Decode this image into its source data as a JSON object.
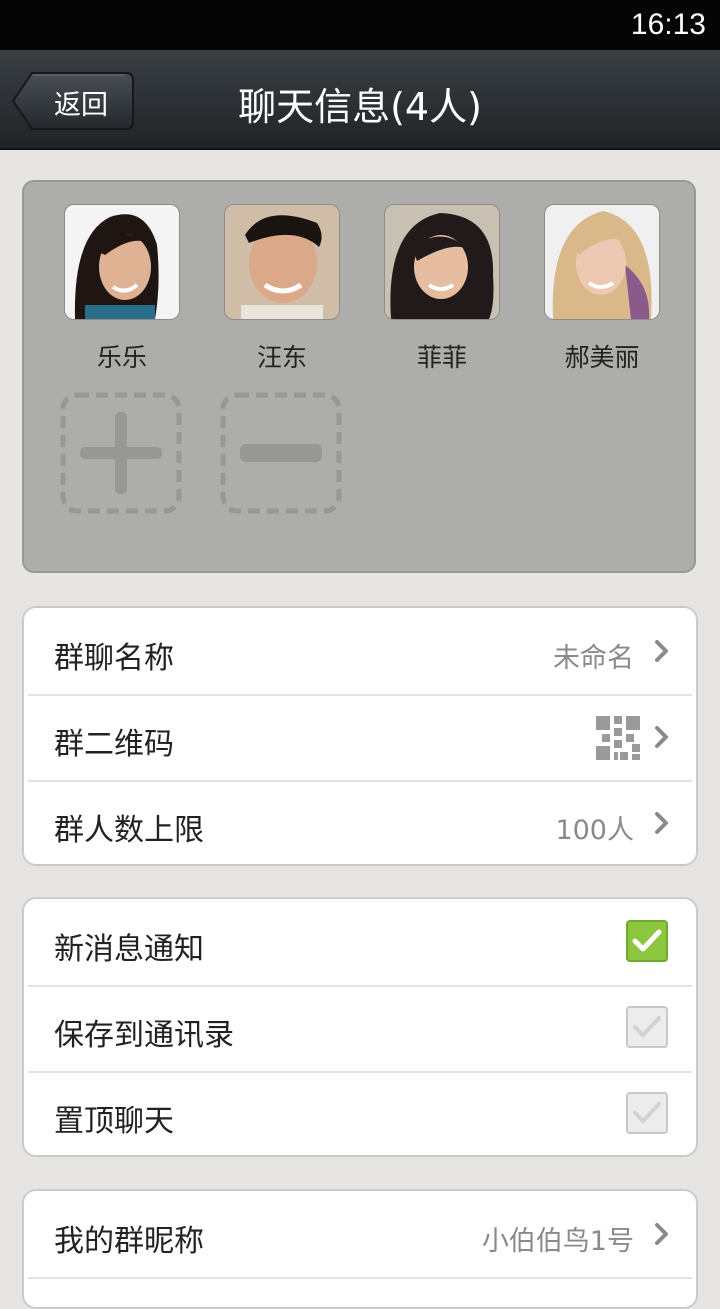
{
  "status_bar": {
    "time": "16:13"
  },
  "nav": {
    "back_label": "返回",
    "title": "聊天信息(4人)"
  },
  "members": [
    {
      "name": "乐乐"
    },
    {
      "name": "汪东"
    },
    {
      "name": "菲菲"
    },
    {
      "name": "郝美丽"
    }
  ],
  "group_settings": {
    "name_label": "群聊名称",
    "name_value": "未命名",
    "qr_label": "群二维码",
    "limit_label": "群人数上限",
    "limit_value": "100人"
  },
  "chat_settings": {
    "notify_label": "新消息通知",
    "notify_checked": true,
    "save_label": "保存到通讯录",
    "save_checked": false,
    "pin_label": "置顶聊天",
    "pin_checked": false
  },
  "profile": {
    "nickname_label": "我的群昵称",
    "nickname_value": "小伯伯鸟1号"
  },
  "colors": {
    "accent_green": "#8cc63f",
    "nav_bg": "#2b2f33",
    "panel_bg": "#adadab"
  }
}
